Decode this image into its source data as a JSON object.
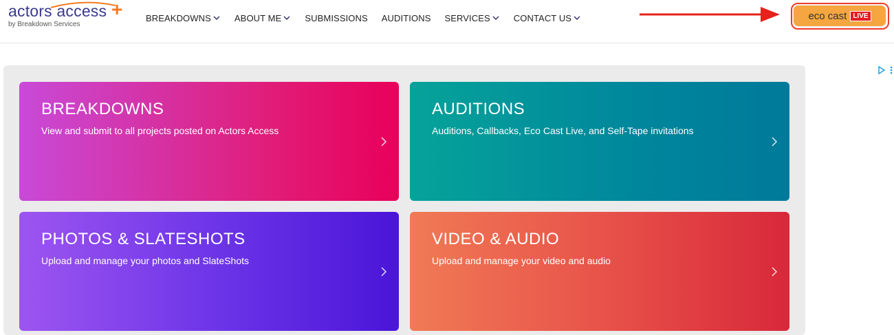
{
  "logo": {
    "main": "actors access",
    "plus": "+",
    "sub": "by Breakdown Services"
  },
  "nav": {
    "items": [
      {
        "label": "BREAKDOWNS",
        "dropdown": true
      },
      {
        "label": "ABOUT ME",
        "dropdown": true
      },
      {
        "label": "SUBMISSIONS",
        "dropdown": false
      },
      {
        "label": "AUDITIONS",
        "dropdown": false
      },
      {
        "label": "SERVICES",
        "dropdown": true
      },
      {
        "label": "CONTACT US",
        "dropdown": true
      }
    ]
  },
  "eco_cast": {
    "label": "eco cast",
    "badge": "LIVE"
  },
  "cards": [
    {
      "title": "BREAKDOWNS",
      "description": "View and submit to all projects posted on Actors Access"
    },
    {
      "title": "AUDITIONS",
      "description": "Auditions, Callbacks, Eco Cast Live, and Self-Tape invitations"
    },
    {
      "title": "PHOTOS & SLATESHOTS",
      "description": "Upload and manage your photos and SlateShots"
    },
    {
      "title": "VIDEO & AUDIO",
      "description": "Upload and manage your video and audio"
    }
  ],
  "colors": {
    "brand_navy": "#3a3a8c",
    "brand_orange": "#f47b20",
    "eco_button": "#f5a640",
    "highlight_red": "#f03c2a",
    "live_red": "#e51c23"
  },
  "icons": [
    "chevron-down-icon",
    "arrow-right-icon",
    "chevron-right-icon",
    "ad-choices-icon",
    "more-vertical-icon"
  ]
}
